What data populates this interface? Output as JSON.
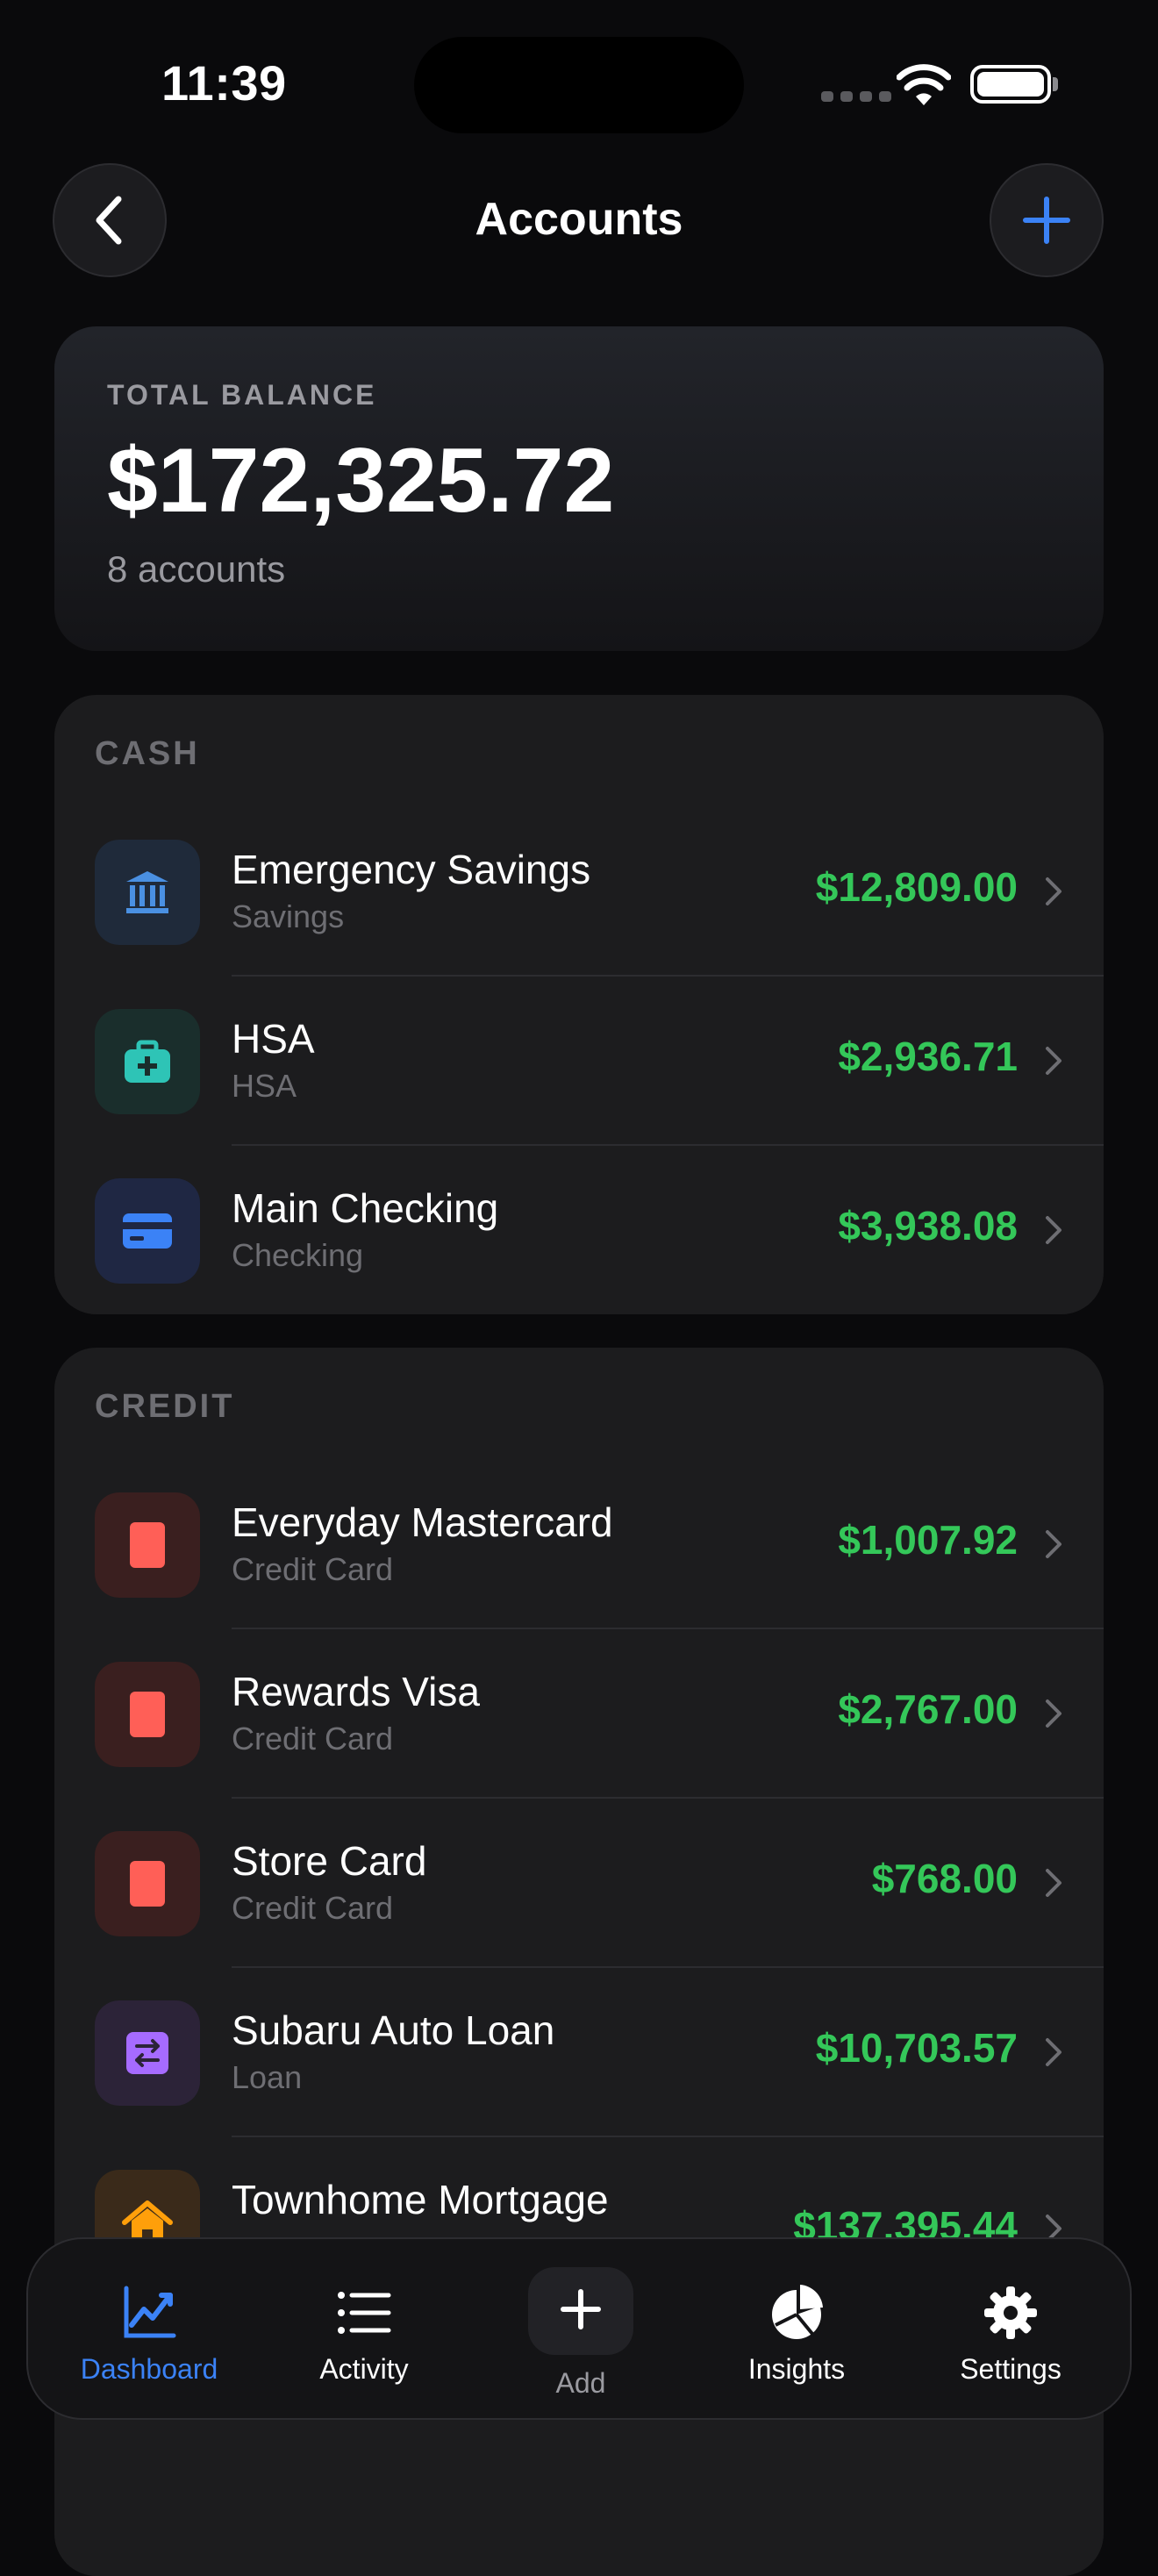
{
  "status": {
    "time": "11:39"
  },
  "header": {
    "title": "Accounts"
  },
  "total": {
    "label": "TOTAL BALANCE",
    "amount": "$172,325.72",
    "sub": "8 accounts"
  },
  "cash": {
    "title": "CASH",
    "items": [
      {
        "name": "Emergency Savings",
        "type": "Savings",
        "amount": "$12,809.00",
        "icon": "bank-icon"
      },
      {
        "name": "HSA",
        "type": "HSA",
        "amount": "$2,936.71",
        "icon": "medical-kit-icon"
      },
      {
        "name": "Main Checking",
        "type": "Checking",
        "amount": "$3,938.08",
        "icon": "credit-card-icon"
      }
    ]
  },
  "credit": {
    "title": "CREDIT",
    "items": [
      {
        "name": "Everyday Mastercard",
        "type": "Credit Card",
        "amount": "$1,007.92",
        "icon": "card-icon"
      },
      {
        "name": "Rewards Visa",
        "type": "Credit Card",
        "amount": "$2,767.00",
        "icon": "card-icon"
      },
      {
        "name": "Store Card",
        "type": "Credit Card",
        "amount": "$768.00",
        "icon": "card-icon"
      },
      {
        "name": "Subaru Auto Loan",
        "type": "Loan",
        "amount": "$10,703.57",
        "icon": "swap-icon"
      },
      {
        "name": "Townhome Mortgage",
        "type": "",
        "amount": "$137,395.44",
        "icon": "house-icon"
      }
    ]
  },
  "tabs": [
    {
      "label": "Dashboard",
      "icon": "chart-line-icon",
      "active": true
    },
    {
      "label": "Activity",
      "icon": "list-icon"
    },
    {
      "label": "Add",
      "icon": "plus-icon"
    },
    {
      "label": "Insights",
      "icon": "pie-chart-icon"
    },
    {
      "label": "Settings",
      "icon": "gear-icon"
    }
  ],
  "colors": {
    "accent": "#3b82f6",
    "positive": "#34c759",
    "card_red": "#ff5f57"
  }
}
